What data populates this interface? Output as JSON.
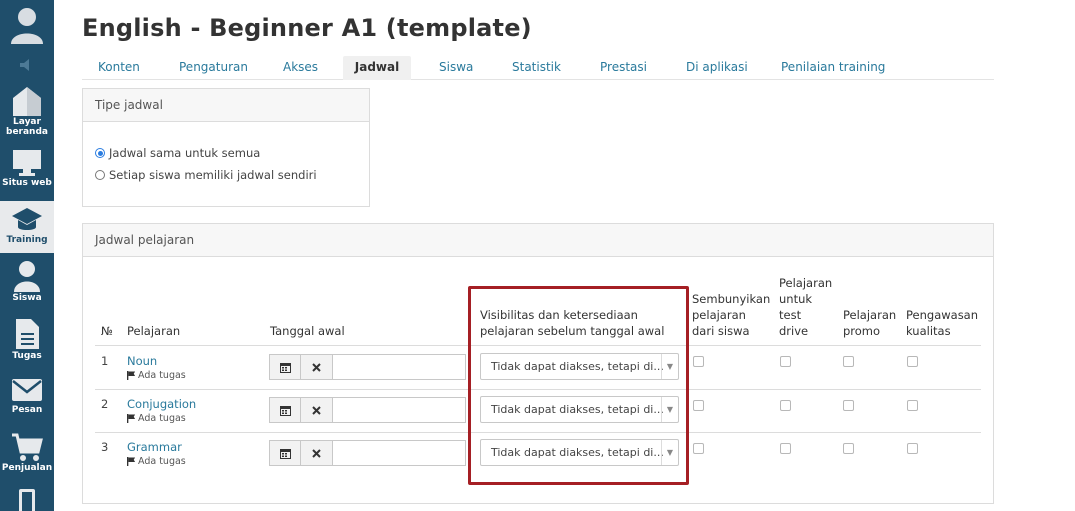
{
  "sidebar": {
    "items": [
      {
        "label": "",
        "icon": "avatar-icon"
      },
      {
        "label": "",
        "icon": "speaker-icon"
      },
      {
        "label": "Layar beranda",
        "icon": "home-icon"
      },
      {
        "label": "Situs web",
        "icon": "monitor-icon"
      },
      {
        "label": "Training",
        "icon": "graduation-cap-icon",
        "active": true
      },
      {
        "label": "Siswa",
        "icon": "user-icon"
      },
      {
        "label": "Tugas",
        "icon": "document-icon"
      },
      {
        "label": "Pesan",
        "icon": "envelope-icon"
      },
      {
        "label": "Penjualan",
        "icon": "cart-icon"
      },
      {
        "label": "",
        "icon": "mobile-icon"
      }
    ],
    "color": "#1f4e6b"
  },
  "page": {
    "title": "English - Beginner A1 (template)"
  },
  "tabs": [
    "Konten",
    "Pengaturan",
    "Akses",
    "Jadwal",
    "Siswa",
    "Statistik",
    "Prestasi",
    "Di aplikasi",
    "Penilaian training"
  ],
  "active_tab": "Jadwal",
  "schedule_type": {
    "title": "Tipe jadwal",
    "options": [
      {
        "label": "Jadwal sama untuk semua",
        "selected": true
      },
      {
        "label": "Setiap siswa memiliki jadwal sendiri",
        "selected": false
      }
    ]
  },
  "lesson_schedule": {
    "title": "Jadwal pelajaran",
    "headers": {
      "no": "№",
      "lesson": "Pelajaran",
      "start_date": "Tanggal awal",
      "visibility_1": "Visibilitas dan ketersediaan",
      "visibility_2": "pelajaran sebelum tanggal awal",
      "hide_1": "Sembunyikan",
      "hide_2": "pelajaran",
      "hide_3": "dari siswa",
      "test_1": "Pelajaran",
      "test_2": "untuk",
      "test_3": "test",
      "test_4": "drive",
      "promo_1": "Pelajaran",
      "promo_2": "promo",
      "quality_1": "Pengawasan",
      "quality_2": "kualitas"
    },
    "rows": [
      {
        "no": "1",
        "lesson": "Noun",
        "has_task": "Ada tugas",
        "start_date": "",
        "visibility": "Tidak dapat diakses, tetapi di..."
      },
      {
        "no": "2",
        "lesson": "Conjugation",
        "has_task": "Ada tugas",
        "start_date": "",
        "visibility": "Tidak dapat diakses, tetapi di..."
      },
      {
        "no": "3",
        "lesson": "Grammar",
        "has_task": "Ada tugas",
        "start_date": "",
        "visibility": "Tidak dapat diakses, tetapi di..."
      }
    ]
  },
  "colors": {
    "link": "#2a7a9c",
    "highlight": "#a51f24",
    "radio": "#2b7de0"
  }
}
